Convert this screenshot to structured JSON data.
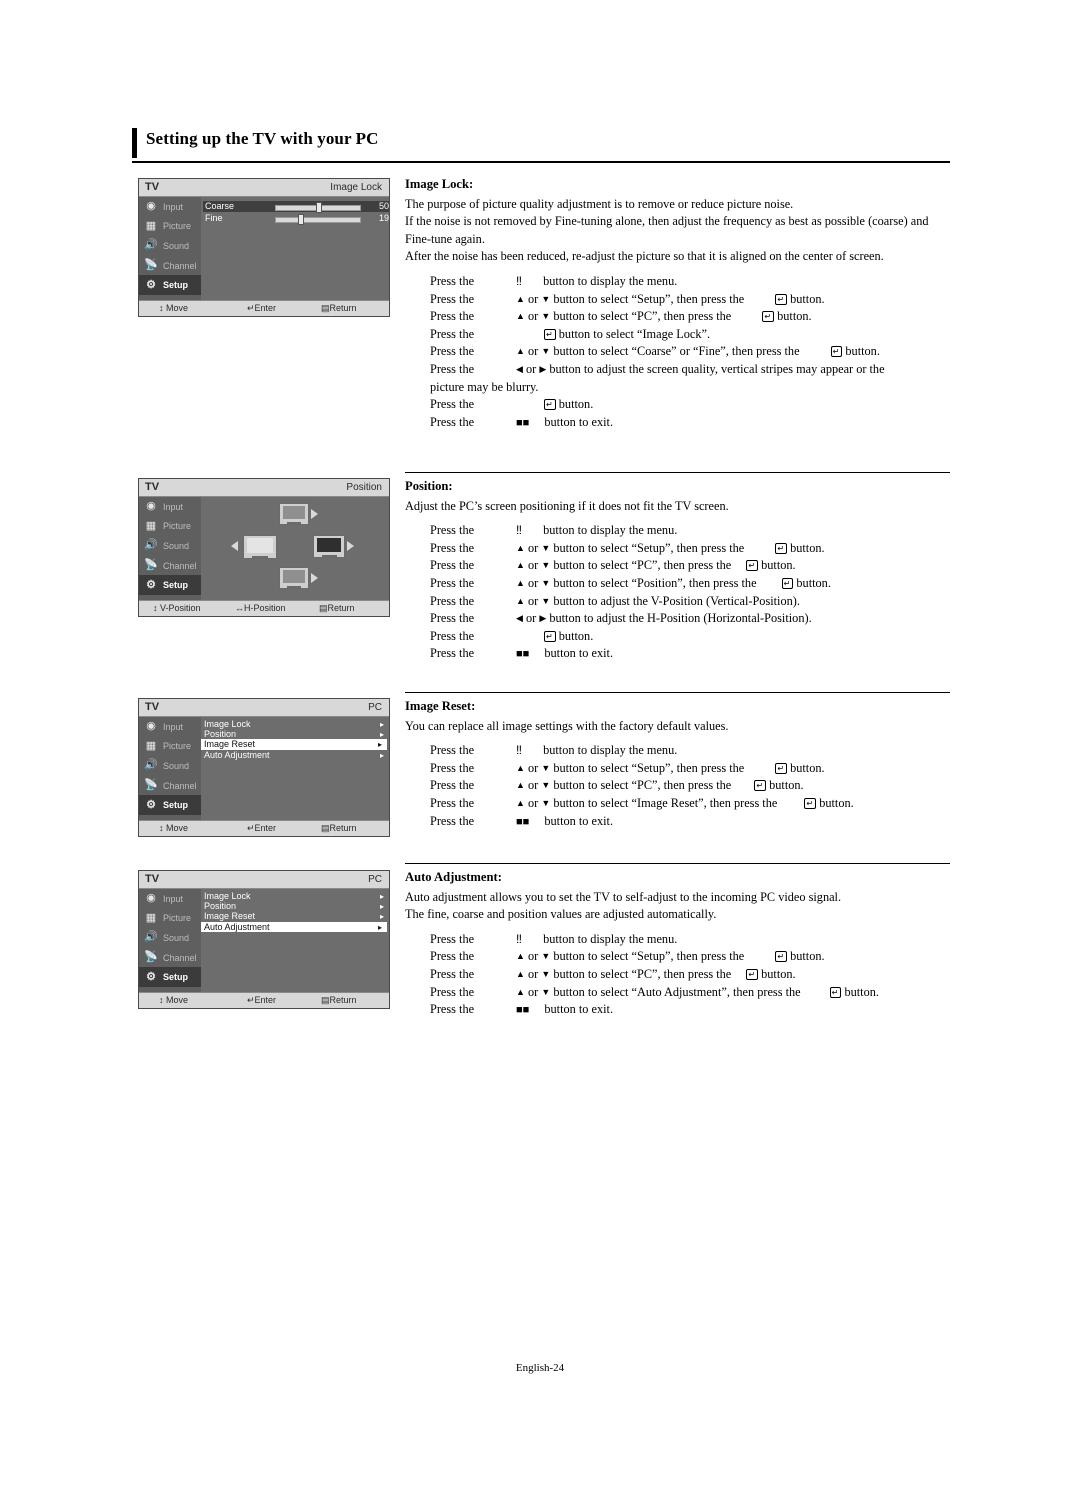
{
  "page": {
    "title": "Setting up the TV with your PC",
    "footer": "English-24"
  },
  "osd_common": {
    "tv_label": "TV",
    "nav": [
      {
        "label": "Input",
        "icon": "input-icon"
      },
      {
        "label": "Picture",
        "icon": "picture-icon"
      },
      {
        "label": "Sound",
        "icon": "sound-icon"
      },
      {
        "label": "Channel",
        "icon": "channel-icon"
      },
      {
        "label": "Setup",
        "icon": "setup-icon"
      }
    ],
    "footer_move": "Move",
    "footer_enter": "Enter",
    "footer_return": "Return",
    "footer_vposition": "V-Position",
    "footer_hposition": "H-Position"
  },
  "osd1": {
    "title": "Image Lock",
    "rows": [
      {
        "name": "Coarse",
        "value": "50"
      },
      {
        "name": "Fine",
        "value": "19"
      }
    ]
  },
  "osd2": {
    "title": "Position"
  },
  "osd3": {
    "title": "PC",
    "items": [
      "Image Lock",
      "Position",
      "Image Reset",
      "Auto Adjustment"
    ],
    "selected": "Image Reset"
  },
  "osd4": {
    "title": "PC",
    "items": [
      "Image Lock",
      "Position",
      "Image Reset",
      "Auto Adjustment"
    ],
    "selected": "Auto Adjustment"
  },
  "sections": [
    {
      "heading": "Image Lock:",
      "paragraphs": [
        "The purpose of picture quality adjustment is to remove or reduce picture noise.",
        "If the noise is not removed by Fine-tuning alone, then adjust the frequency as best as possible (coarse) and Fine-tune again.",
        "After the noise has been reduced, re-adjust the picture so that it is aligned on the center of screen."
      ],
      "steps": [
        "Press the MENU button to display the menu.",
        "Press the ▲ or ▼ button to select “Setup”, then press the ENTER button.",
        "Press the ▲ or ▼ button to select “PC”, then press the ENTER button.",
        "Press the ENTER button to select “Image Lock”.",
        "Press the ▲ or ▼ button to select “Coarse” or “Fine”, then press the ENTER button.",
        "Press the ◄ or ► button to adjust the screen quality, vertical stripes may appear or the picture may be blurry.",
        "Press the ENTER button.",
        "Press the EXIT button to exit."
      ]
    },
    {
      "heading": "Position:",
      "paragraphs": [
        "Adjust the PC’s screen positioning if it does not fit the TV screen."
      ],
      "steps": [
        "Press the MENU button to display the menu.",
        "Press the ▲ or ▼ button to select “Setup”, then press the ENTER button.",
        "Press the ▲ or ▼ button to select “PC”, then press the ENTER button.",
        "Press the ▲ or ▼ button to select “Position”, then press the ENTER button.",
        "Press the ▲ or ▼ button to adjust the V-Position (Vertical-Position).",
        "Press the ◄ or ► button to adjust the H-Position (Horizontal-Position).",
        "Press the ENTER button.",
        "Press the EXIT button to exit."
      ]
    },
    {
      "heading": "Image Reset:",
      "paragraphs": [
        "You can replace all image settings with the factory default values."
      ],
      "steps": [
        "Press the MENU button to display the menu.",
        "Press the ▲ or ▼ button to select “Setup”, then press the ENTER button.",
        "Press the ▲ or ▼ button to select “PC”, then press the ENTER button.",
        "Press the ▲ or ▼ button to select “Image Reset”, then press the ENTER button.",
        "Press the EXIT button to exit."
      ]
    },
    {
      "heading": "Auto Adjustment:",
      "paragraphs": [
        "Auto adjustment allows you to set the TV to self-adjust to the incoming PC video signal.",
        "The fine, coarse and position values are adjusted automatically."
      ],
      "steps": [
        "Press the MENU button to display the menu.",
        "Press the ▲ or ▼ button to select “Setup”, then press the ENTER button.",
        "Press the ▲ or ▼ button to select “PC”, then press the ENTER button.",
        "Press the ▲ or ▼ button to select “Auto Adjustment”, then press the ENTER button.",
        "Press the EXIT button to exit."
      ]
    }
  ],
  "step_text": {
    "press": "Press the",
    "menu_suffix": "button to display the menu.",
    "or": "or",
    "setup_mid": "button to select “Setup”, then press the",
    "pc_mid": "button to select “PC”, then press the",
    "button_word": "button.",
    "imagelock_sel": "button to select “Image Lock”.",
    "coarsefine_mid": "button to select “Coarse” or “Fine”, then press the",
    "quality_1": "button to adjust the screen quality, vertical stripes may appear or the",
    "quality_2": "picture may be blurry.",
    "exit_suffix": "button to exit.",
    "position_mid": "button to select “Position”, then press the",
    "vpos": "button to adjust the V-Position (Vertical-Position).",
    "hpos": "button to adjust the H-Position (Horizontal-Position).",
    "imagereset_mid": "button to select “Image Reset”, then press the",
    "autoadj_mid": "button to select “Auto Adjustment”, then press the"
  }
}
